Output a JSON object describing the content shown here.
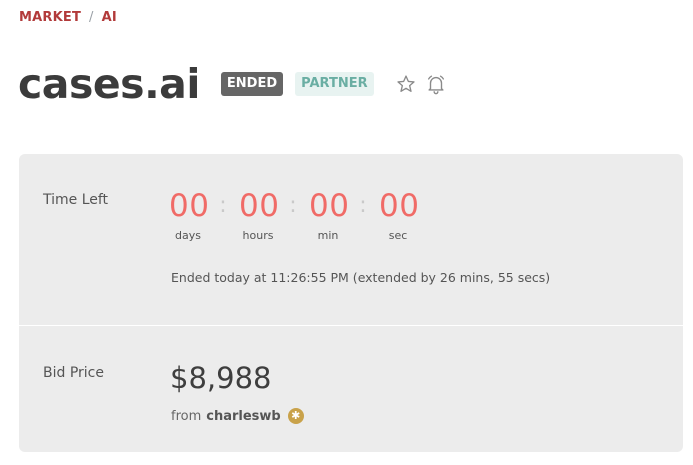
{
  "breadcrumb": {
    "items": [
      "MARKET",
      "AI"
    ],
    "separator": "/"
  },
  "header": {
    "title": "cases.ai",
    "status_badge": "ENDED",
    "partner_badge": "PARTNER",
    "icons": [
      "star-icon",
      "bell-icon"
    ]
  },
  "time_left": {
    "label": "Time Left",
    "units": [
      {
        "value": "00",
        "label": "days"
      },
      {
        "value": "00",
        "label": "hours"
      },
      {
        "value": "00",
        "label": "min"
      },
      {
        "value": "00",
        "label": "sec"
      }
    ],
    "separator": ":",
    "ended_note": "Ended today at 11:26:55 PM (extended by 26 mins, 55 secs)"
  },
  "bid": {
    "label": "Bid Price",
    "price": "$8,988",
    "from_prefix": "from",
    "bidder": "charleswb",
    "bidder_badge_icon": "star-badge-icon"
  },
  "colors": {
    "breadcrumb": "#b23a3a",
    "countdown": "#f06b67",
    "ended_badge_bg": "#666666",
    "partner_badge_bg": "#e8f3f1",
    "partner_badge_text": "#6aaea3",
    "panel_bg": "#ececec"
  }
}
